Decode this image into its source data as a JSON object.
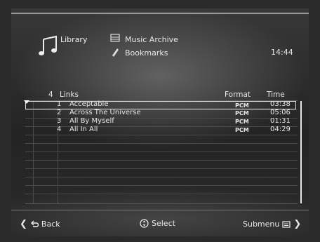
{
  "header": {
    "library": "Library",
    "music_archive": "Music Archive",
    "bookmarks": "Bookmarks",
    "clock": "14:44"
  },
  "table": {
    "count": "4",
    "columns": {
      "name": "Links",
      "format": "Format",
      "time": "Time"
    },
    "rows": [
      {
        "num": "1",
        "title": "Acceptable",
        "format": "PCM",
        "time": "03:38",
        "selected": true
      },
      {
        "num": "2",
        "title": "Across The Universe",
        "format": "PCM",
        "time": "05:06"
      },
      {
        "num": "3",
        "title": "All By Myself",
        "format": "PCM",
        "time": "01:31"
      },
      {
        "num": "4",
        "title": "All In All",
        "format": "PCM",
        "time": "04:29"
      }
    ]
  },
  "footer": {
    "back": "Back",
    "select": "Select",
    "submenu": "Submenu"
  },
  "icons": {
    "library": "music-note-icon",
    "music_archive": "archive-icon",
    "bookmarks": "bookmark-icon",
    "back": "back-arrow-icon",
    "select": "dpad-icon",
    "submenu": "submenu-icon"
  }
}
